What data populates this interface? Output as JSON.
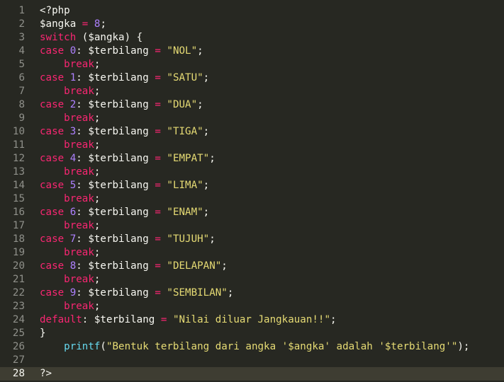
{
  "colors": {
    "background": "#272822",
    "active_line": "#3E3D32",
    "gutter_text": "#8F908A",
    "plain": "#F8F8F2",
    "keyword": "#F92672",
    "number": "#AE81FF",
    "string": "#E6DB74",
    "function": "#66D9EF"
  },
  "active_line": 28,
  "lines": [
    {
      "n": "1",
      "tokens": [
        {
          "t": "<?php",
          "c": "pl"
        }
      ]
    },
    {
      "n": "2",
      "tokens": [
        {
          "t": "$angka ",
          "c": "pl"
        },
        {
          "t": "=",
          "c": "op"
        },
        {
          "t": " ",
          "c": "pl"
        },
        {
          "t": "8",
          "c": "num"
        },
        {
          "t": ";",
          "c": "pl"
        }
      ]
    },
    {
      "n": "3",
      "tokens": [
        {
          "t": "switch",
          "c": "kw"
        },
        {
          "t": " ($angka) {",
          "c": "pl"
        }
      ]
    },
    {
      "n": "4",
      "tokens": [
        {
          "t": "case",
          "c": "kw"
        },
        {
          "t": " ",
          "c": "pl"
        },
        {
          "t": "0",
          "c": "num"
        },
        {
          "t": ": $terbilang ",
          "c": "pl"
        },
        {
          "t": "=",
          "c": "op"
        },
        {
          "t": " ",
          "c": "pl"
        },
        {
          "t": "\"NOL\"",
          "c": "str"
        },
        {
          "t": ";",
          "c": "pl"
        }
      ]
    },
    {
      "n": "5",
      "tokens": [
        {
          "t": "    ",
          "c": "pl"
        },
        {
          "t": "break",
          "c": "kw"
        },
        {
          "t": ";",
          "c": "pl"
        }
      ]
    },
    {
      "n": "6",
      "tokens": [
        {
          "t": "case",
          "c": "kw"
        },
        {
          "t": " ",
          "c": "pl"
        },
        {
          "t": "1",
          "c": "num"
        },
        {
          "t": ": $terbilang ",
          "c": "pl"
        },
        {
          "t": "=",
          "c": "op"
        },
        {
          "t": " ",
          "c": "pl"
        },
        {
          "t": "\"SATU\"",
          "c": "str"
        },
        {
          "t": ";",
          "c": "pl"
        }
      ]
    },
    {
      "n": "7",
      "tokens": [
        {
          "t": "    ",
          "c": "pl"
        },
        {
          "t": "break",
          "c": "kw"
        },
        {
          "t": ";",
          "c": "pl"
        }
      ]
    },
    {
      "n": "8",
      "tokens": [
        {
          "t": "case",
          "c": "kw"
        },
        {
          "t": " ",
          "c": "pl"
        },
        {
          "t": "2",
          "c": "num"
        },
        {
          "t": ": $terbilang ",
          "c": "pl"
        },
        {
          "t": "=",
          "c": "op"
        },
        {
          "t": " ",
          "c": "pl"
        },
        {
          "t": "\"DUA\"",
          "c": "str"
        },
        {
          "t": ";",
          "c": "pl"
        }
      ]
    },
    {
      "n": "9",
      "tokens": [
        {
          "t": "    ",
          "c": "pl"
        },
        {
          "t": "break",
          "c": "kw"
        },
        {
          "t": ";",
          "c": "pl"
        }
      ]
    },
    {
      "n": "10",
      "tokens": [
        {
          "t": "case",
          "c": "kw"
        },
        {
          "t": " ",
          "c": "pl"
        },
        {
          "t": "3",
          "c": "num"
        },
        {
          "t": ": $terbilang ",
          "c": "pl"
        },
        {
          "t": "=",
          "c": "op"
        },
        {
          "t": " ",
          "c": "pl"
        },
        {
          "t": "\"TIGA\"",
          "c": "str"
        },
        {
          "t": ";",
          "c": "pl"
        }
      ]
    },
    {
      "n": "11",
      "tokens": [
        {
          "t": "    ",
          "c": "pl"
        },
        {
          "t": "break",
          "c": "kw"
        },
        {
          "t": ";",
          "c": "pl"
        }
      ]
    },
    {
      "n": "12",
      "tokens": [
        {
          "t": "case",
          "c": "kw"
        },
        {
          "t": " ",
          "c": "pl"
        },
        {
          "t": "4",
          "c": "num"
        },
        {
          "t": ": $terbilang ",
          "c": "pl"
        },
        {
          "t": "=",
          "c": "op"
        },
        {
          "t": " ",
          "c": "pl"
        },
        {
          "t": "\"EMPAT\"",
          "c": "str"
        },
        {
          "t": ";",
          "c": "pl"
        }
      ]
    },
    {
      "n": "13",
      "tokens": [
        {
          "t": "    ",
          "c": "pl"
        },
        {
          "t": "break",
          "c": "kw"
        },
        {
          "t": ";",
          "c": "pl"
        }
      ]
    },
    {
      "n": "14",
      "tokens": [
        {
          "t": "case",
          "c": "kw"
        },
        {
          "t": " ",
          "c": "pl"
        },
        {
          "t": "5",
          "c": "num"
        },
        {
          "t": ": $terbilang ",
          "c": "pl"
        },
        {
          "t": "=",
          "c": "op"
        },
        {
          "t": " ",
          "c": "pl"
        },
        {
          "t": "\"LIMA\"",
          "c": "str"
        },
        {
          "t": ";",
          "c": "pl"
        }
      ]
    },
    {
      "n": "15",
      "tokens": [
        {
          "t": "    ",
          "c": "pl"
        },
        {
          "t": "break",
          "c": "kw"
        },
        {
          "t": ";",
          "c": "pl"
        }
      ]
    },
    {
      "n": "16",
      "tokens": [
        {
          "t": "case",
          "c": "kw"
        },
        {
          "t": " ",
          "c": "pl"
        },
        {
          "t": "6",
          "c": "num"
        },
        {
          "t": ": $terbilang ",
          "c": "pl"
        },
        {
          "t": "=",
          "c": "op"
        },
        {
          "t": " ",
          "c": "pl"
        },
        {
          "t": "\"ENAM\"",
          "c": "str"
        },
        {
          "t": ";",
          "c": "pl"
        }
      ]
    },
    {
      "n": "17",
      "tokens": [
        {
          "t": "    ",
          "c": "pl"
        },
        {
          "t": "break",
          "c": "kw"
        },
        {
          "t": ";",
          "c": "pl"
        }
      ]
    },
    {
      "n": "18",
      "tokens": [
        {
          "t": "case",
          "c": "kw"
        },
        {
          "t": " ",
          "c": "pl"
        },
        {
          "t": "7",
          "c": "num"
        },
        {
          "t": ": $terbilang ",
          "c": "pl"
        },
        {
          "t": "=",
          "c": "op"
        },
        {
          "t": " ",
          "c": "pl"
        },
        {
          "t": "\"TUJUH\"",
          "c": "str"
        },
        {
          "t": ";",
          "c": "pl"
        }
      ]
    },
    {
      "n": "19",
      "tokens": [
        {
          "t": "    ",
          "c": "pl"
        },
        {
          "t": "break",
          "c": "kw"
        },
        {
          "t": ";",
          "c": "pl"
        }
      ]
    },
    {
      "n": "20",
      "tokens": [
        {
          "t": "case",
          "c": "kw"
        },
        {
          "t": " ",
          "c": "pl"
        },
        {
          "t": "8",
          "c": "num"
        },
        {
          "t": ": $terbilang ",
          "c": "pl"
        },
        {
          "t": "=",
          "c": "op"
        },
        {
          "t": " ",
          "c": "pl"
        },
        {
          "t": "\"DELAPAN\"",
          "c": "str"
        },
        {
          "t": ";",
          "c": "pl"
        }
      ]
    },
    {
      "n": "21",
      "tokens": [
        {
          "t": "    ",
          "c": "pl"
        },
        {
          "t": "break",
          "c": "kw"
        },
        {
          "t": ";",
          "c": "pl"
        }
      ]
    },
    {
      "n": "22",
      "tokens": [
        {
          "t": "case",
          "c": "kw"
        },
        {
          "t": " ",
          "c": "pl"
        },
        {
          "t": "9",
          "c": "num"
        },
        {
          "t": ": $terbilang ",
          "c": "pl"
        },
        {
          "t": "=",
          "c": "op"
        },
        {
          "t": " ",
          "c": "pl"
        },
        {
          "t": "\"SEMBILAN\"",
          "c": "str"
        },
        {
          "t": ";",
          "c": "pl"
        }
      ]
    },
    {
      "n": "23",
      "tokens": [
        {
          "t": "    ",
          "c": "pl"
        },
        {
          "t": "break",
          "c": "kw"
        },
        {
          "t": ";",
          "c": "pl"
        }
      ]
    },
    {
      "n": "24",
      "tokens": [
        {
          "t": "default",
          "c": "kw"
        },
        {
          "t": ": $terbilang ",
          "c": "pl"
        },
        {
          "t": "=",
          "c": "op"
        },
        {
          "t": " ",
          "c": "pl"
        },
        {
          "t": "\"Nilai diluar Jangkauan!!\"",
          "c": "str"
        },
        {
          "t": ";",
          "c": "pl"
        }
      ]
    },
    {
      "n": "25",
      "tokens": [
        {
          "t": "}",
          "c": "pl"
        }
      ]
    },
    {
      "n": "26",
      "tokens": [
        {
          "t": "    ",
          "c": "pl"
        },
        {
          "t": "printf",
          "c": "fn"
        },
        {
          "t": "(",
          "c": "pl"
        },
        {
          "t": "\"Bentuk terbilang dari angka '$angka' adalah '$terbilang'\"",
          "c": "str"
        },
        {
          "t": ");",
          "c": "pl"
        }
      ]
    },
    {
      "n": "27",
      "tokens": []
    },
    {
      "n": "28",
      "tokens": [
        {
          "t": "?>",
          "c": "pl"
        }
      ]
    }
  ]
}
